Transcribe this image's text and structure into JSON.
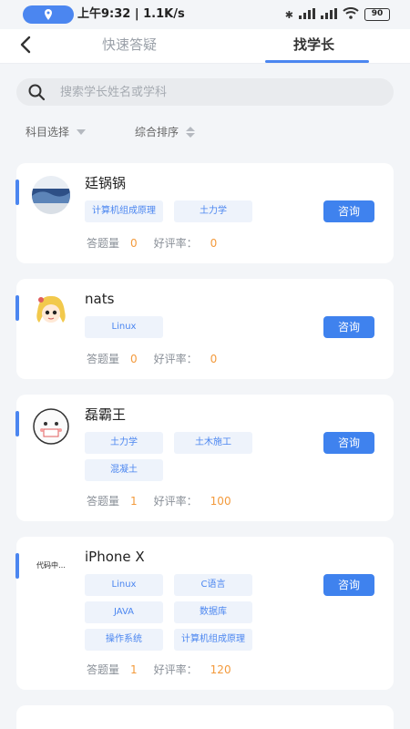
{
  "status_bar": {
    "text": "上午9:32 | 1.1K/s",
    "battery": "90"
  },
  "nav": {
    "tabs": [
      {
        "label": "快速答疑"
      },
      {
        "label": "找学长"
      }
    ]
  },
  "search": {
    "placeholder": "搜索学长姓名或学科"
  },
  "filters": {
    "subject_label": "科目选择",
    "sort_label": "综合排序"
  },
  "stats_labels": {
    "answers": "答题量",
    "rating": "好评率："
  },
  "consult_label": "咨询",
  "mentors": [
    {
      "name": "廷锅锅",
      "tags": [
        "计算机组成原理",
        "土力学"
      ],
      "answers": "0",
      "rating": "0"
    },
    {
      "name": "nats",
      "tags": [
        "Linux"
      ],
      "answers": "0",
      "rating": "0"
    },
    {
      "name": "磊霸王",
      "tags": [
        "土力学",
        "土木施工",
        "混凝土"
      ],
      "answers": "1",
      "rating": "100"
    },
    {
      "name": "iPhone X",
      "tags": [
        "Linux",
        "C语言",
        "JAVA",
        "数据库",
        "操作系统",
        "计算机组成原理"
      ],
      "answers": "1",
      "rating": "120",
      "avatar_text": "代码中…"
    }
  ],
  "colors": {
    "accent": "#4b86f0",
    "button": "#3f82ee",
    "highlight": "#f39a3c"
  }
}
